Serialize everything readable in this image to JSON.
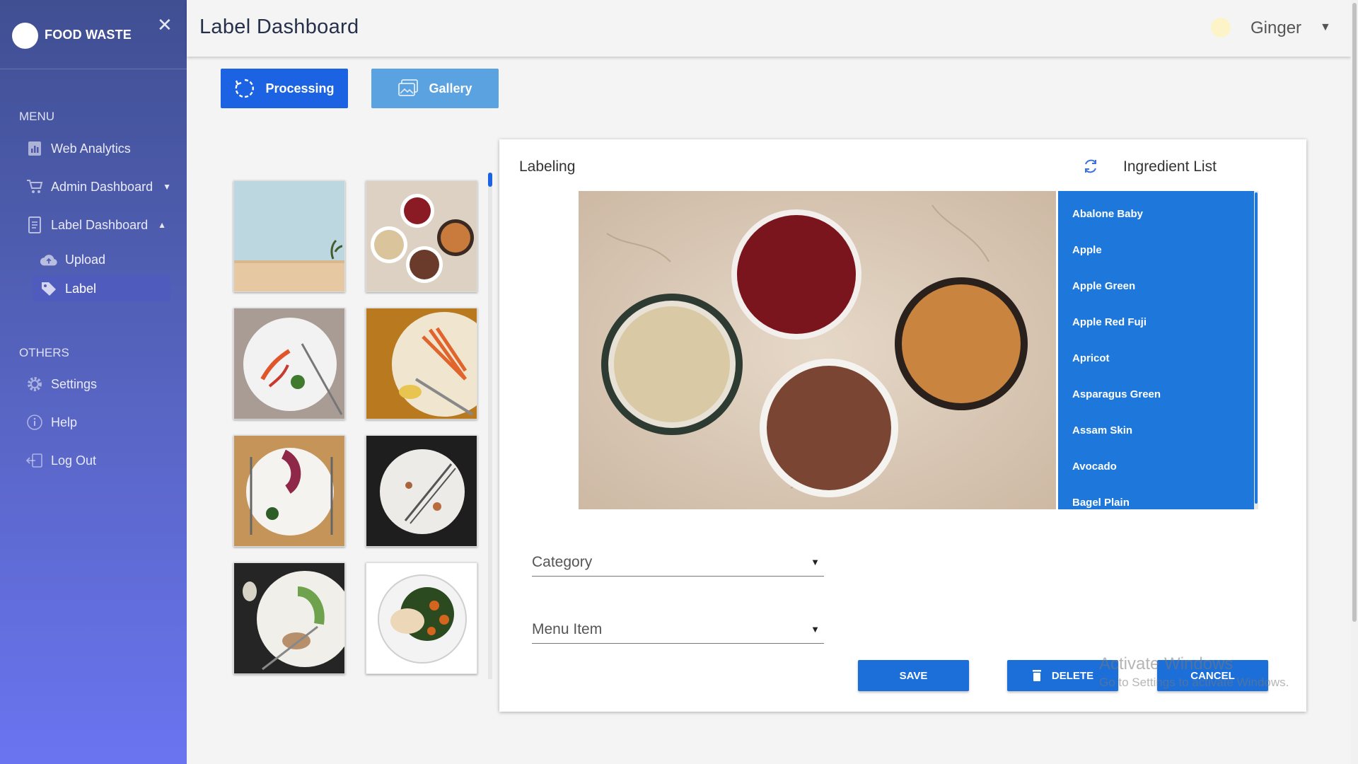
{
  "sidebar": {
    "brand": "FOOD WASTE",
    "menu_heading": "MENU",
    "items": [
      {
        "label": "Web Analytics"
      },
      {
        "label": "Admin Dashboard"
      },
      {
        "label": "Label Dashboard"
      }
    ],
    "subitems": [
      {
        "label": "Upload"
      },
      {
        "label": "Label",
        "active": true
      }
    ],
    "others_heading": "OTHERS",
    "others": [
      {
        "label": "Settings"
      },
      {
        "label": "Help"
      },
      {
        "label": "Log Out"
      }
    ]
  },
  "header": {
    "title": "Label Dashboard",
    "user": "Ginger"
  },
  "tabs": {
    "processing": "Processing",
    "gallery": "Gallery"
  },
  "labeling": {
    "title": "Labeling",
    "ingredient_title": "Ingredient List",
    "ingredients": [
      "Abalone Baby",
      "Apple",
      "Apple Green",
      "Apple Red Fuji",
      "Apricot",
      "Asparagus Green",
      "Assam Skin",
      "Avocado",
      "Bagel Plain"
    ],
    "category_label": "Category",
    "menu_item_label": "Menu Item",
    "save": "SAVE",
    "delete": "DELETE",
    "cancel": "CANCEL"
  },
  "watermark": {
    "line1": "Activate Windows",
    "line2": "Go to Settings to activate Windows."
  },
  "colors": {
    "primary": "#1c63e4",
    "gallery_button": "#5ba2e0",
    "ingredient_list": "#1e78dc",
    "sidebar_top": "#404f92",
    "sidebar_bottom": "#6a74f0"
  }
}
